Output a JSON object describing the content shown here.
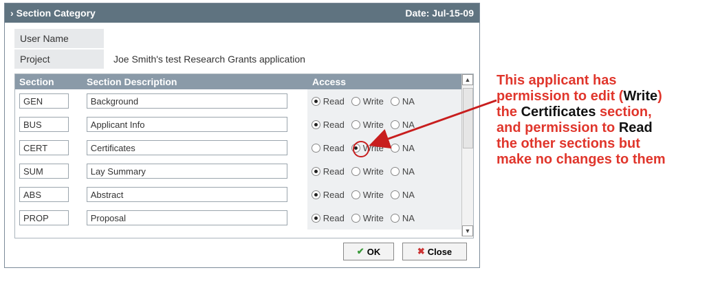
{
  "dialog": {
    "title": "Section Category",
    "date": "Date: Jul-15-09",
    "user_name_label": "User Name",
    "user_name_value": "",
    "project_label": "Project",
    "project_value": "Joe Smith's test Research Grants application"
  },
  "grid": {
    "headers": [
      "Section",
      "Section Description",
      "Access"
    ],
    "rows": [
      {
        "code": "GEN",
        "desc": "Background",
        "access": "Read"
      },
      {
        "code": "BUS",
        "desc": "Applicant Info",
        "access": "Read"
      },
      {
        "code": "CERT",
        "desc": "Certificates",
        "access": "Write"
      },
      {
        "code": "SUM",
        "desc": "Lay Summary",
        "access": "Read"
      },
      {
        "code": "ABS",
        "desc": "Abstract",
        "access": "Read"
      },
      {
        "code": "PROP",
        "desc": "Proposal",
        "access": "Read"
      }
    ],
    "options": [
      "Read",
      "Write",
      "NA"
    ]
  },
  "buttons": {
    "ok": "OK",
    "close": "Close"
  },
  "annotation": {
    "l1": "This applicant has",
    "l2a": "permission to edit (",
    "l2b": "Write",
    "l2c": ")",
    "l3a": "the ",
    "l3b": "Certificates",
    "l3c": " section,",
    "l4a": "and permission to ",
    "l4b": "Read",
    "l5": "the other sections but",
    "l6": "make no changes to them"
  },
  "colors": {
    "title_bar": "#5f7380",
    "header": "#8a9aa8",
    "annotation": "#e0362c"
  }
}
